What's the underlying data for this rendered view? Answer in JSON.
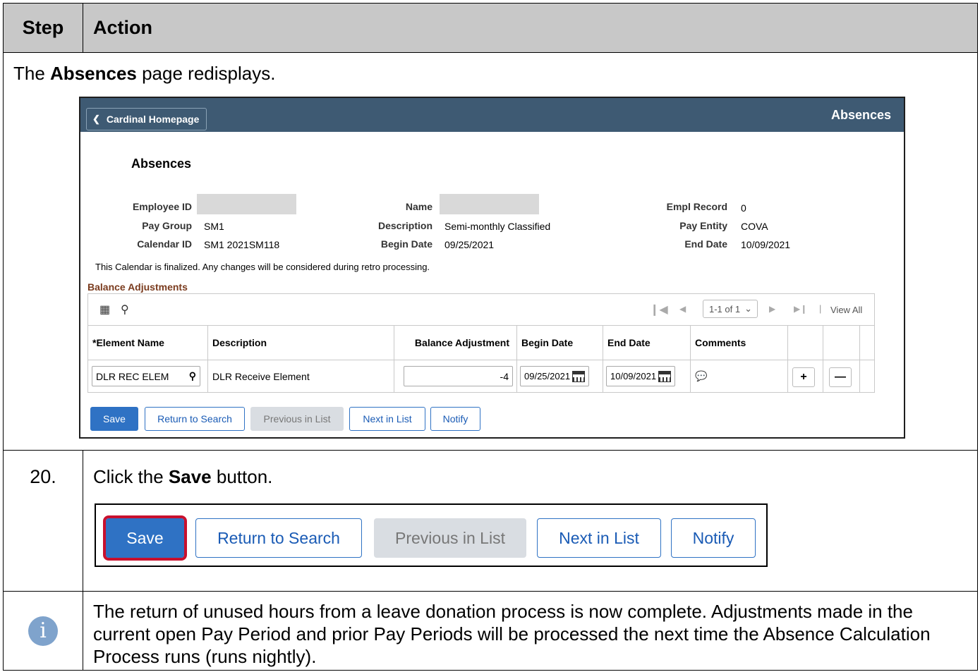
{
  "header": {
    "step": "Step",
    "action": "Action"
  },
  "intro": {
    "prefix": "The ",
    "bold": "Absences",
    "suffix": " page redisplays."
  },
  "screen": {
    "home_button": "Cardinal Homepage",
    "banner_title": "Absences",
    "page_title": "Absences",
    "fields": {
      "employee_id_label": "Employee ID",
      "pay_group_label": "Pay Group",
      "pay_group": "SM1",
      "calendar_id_label": "Calendar ID",
      "calendar_id": "SM1 2021SM118",
      "name_label": "Name",
      "description_label": "Description",
      "description": "Semi-monthly Classified",
      "begin_date_label": "Begin Date",
      "begin_date": "09/25/2021",
      "empl_record_label": "Empl Record",
      "empl_record": "0",
      "pay_entity_label": "Pay Entity",
      "pay_entity": "COVA",
      "end_date_label": "End Date",
      "end_date": "10/09/2021"
    },
    "notice": "This Calendar is finalized. Any changes will be considered during retro processing.",
    "section_title": "Balance Adjustments",
    "pager": {
      "range": "1-1 of 1",
      "view_all": "View All"
    },
    "columns": [
      "*Element Name",
      "Description",
      "Balance Adjustment",
      "Begin Date",
      "End Date",
      "Comments"
    ],
    "row": {
      "element_name": "DLR REC ELEM",
      "description": "DLR Receive Element",
      "balance_adjustment": "-4",
      "begin_date": "09/25/2021",
      "end_date": "10/09/2021"
    },
    "buttons": {
      "save": "Save",
      "return": "Return to Search",
      "previous": "Previous in List",
      "next": "Next in List",
      "notify": "Notify"
    }
  },
  "step": {
    "number": "20.",
    "prefix": "Click the ",
    "bold": "Save",
    "suffix": " button.",
    "buttons": {
      "save": "Save",
      "return": "Return to Search",
      "previous": "Previous in List",
      "next": "Next in List",
      "notify": "Notify"
    }
  },
  "info": {
    "icon": "info-icon",
    "text": "The return of unused hours from a leave donation process is now complete. Adjustments made in the current open Pay Period and prior Pay Periods will be processed the next time the Absence Calculation Process runs (runs nightly)."
  },
  "colors": {
    "banner": "#3e5a73",
    "primary": "#2f72c4",
    "highlight": "#c8102e",
    "section": "#7a3b1e"
  }
}
